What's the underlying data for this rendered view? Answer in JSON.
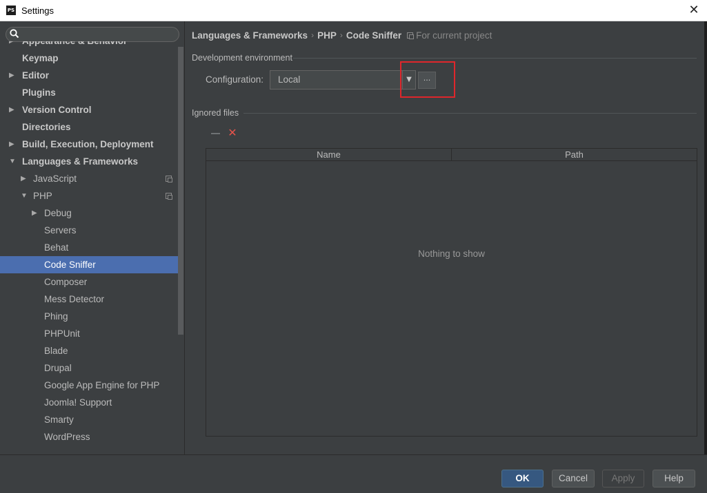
{
  "window": {
    "title": "Settings",
    "app_icon_text": "PS"
  },
  "search": {
    "placeholder": ""
  },
  "tree": [
    {
      "label": "Appearance & Behavior",
      "level": 0,
      "arrow": "right",
      "bold": true,
      "partial": true
    },
    {
      "label": "Keymap",
      "level": 0,
      "arrow": "",
      "bold": true
    },
    {
      "label": "Editor",
      "level": 0,
      "arrow": "right",
      "bold": true
    },
    {
      "label": "Plugins",
      "level": 0,
      "arrow": "",
      "bold": true
    },
    {
      "label": "Version Control",
      "level": 0,
      "arrow": "right",
      "bold": true
    },
    {
      "label": "Directories",
      "level": 0,
      "arrow": "",
      "bold": true
    },
    {
      "label": "Build, Execution, Deployment",
      "level": 0,
      "arrow": "right",
      "bold": true
    },
    {
      "label": "Languages & Frameworks",
      "level": 0,
      "arrow": "down",
      "bold": true
    },
    {
      "label": "JavaScript",
      "level": 1,
      "arrow": "right",
      "project": true
    },
    {
      "label": "PHP",
      "level": 1,
      "arrow": "down",
      "project": true
    },
    {
      "label": "Debug",
      "level": 2,
      "arrow": "right"
    },
    {
      "label": "Servers",
      "level": 2,
      "arrow": ""
    },
    {
      "label": "Behat",
      "level": 2,
      "arrow": ""
    },
    {
      "label": "Code Sniffer",
      "level": 2,
      "arrow": "",
      "selected": true
    },
    {
      "label": "Composer",
      "level": 2,
      "arrow": ""
    },
    {
      "label": "Mess Detector",
      "level": 2,
      "arrow": ""
    },
    {
      "label": "Phing",
      "level": 2,
      "arrow": ""
    },
    {
      "label": "PHPUnit",
      "level": 2,
      "arrow": ""
    },
    {
      "label": "Blade",
      "level": 2,
      "arrow": ""
    },
    {
      "label": "Drupal",
      "level": 2,
      "arrow": ""
    },
    {
      "label": "Google App Engine for PHP",
      "level": 2,
      "arrow": ""
    },
    {
      "label": "Joomla! Support",
      "level": 2,
      "arrow": ""
    },
    {
      "label": "Smarty",
      "level": 2,
      "arrow": ""
    },
    {
      "label": "WordPress",
      "level": 2,
      "arrow": ""
    }
  ],
  "breadcrumb": {
    "parts": [
      "Languages & Frameworks",
      "PHP",
      "Code Sniffer"
    ],
    "separator": "›",
    "project_note": "For current project"
  },
  "dev_env": {
    "title": "Development environment",
    "config_label": "Configuration:",
    "config_value": "Local",
    "dots_label": "..."
  },
  "ignored": {
    "title": "Ignored files",
    "columns": [
      "Name",
      "Path"
    ],
    "empty_text": "Nothing to show"
  },
  "buttons": {
    "ok": "OK",
    "cancel": "Cancel",
    "apply": "Apply",
    "help": "Help"
  },
  "colors": {
    "selection": "#4b6eaf",
    "highlight_box": "#e0262b",
    "remove_icon": "#e5534b",
    "ok_button": "#365880"
  }
}
